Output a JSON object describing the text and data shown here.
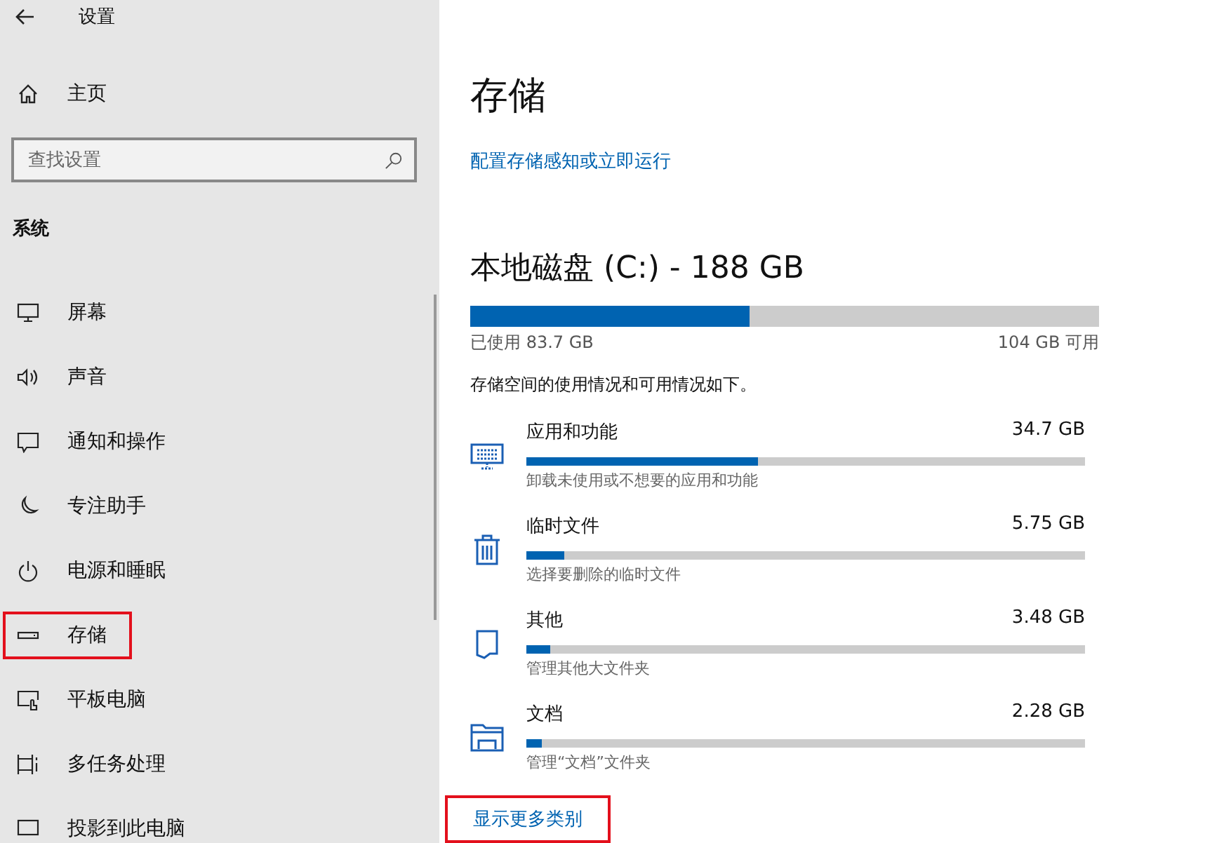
{
  "window": {
    "title": "设置"
  },
  "sidebar": {
    "home": "主页",
    "search": {
      "placeholder": "查找设置"
    },
    "section": "系统",
    "items": [
      {
        "label": "屏幕",
        "highlighted": false
      },
      {
        "label": "声音",
        "highlighted": false
      },
      {
        "label": "通知和操作",
        "highlighted": false
      },
      {
        "label": "专注助手",
        "highlighted": false
      },
      {
        "label": "电源和睡眠",
        "highlighted": false
      },
      {
        "label": "存储",
        "highlighted": true
      },
      {
        "label": "平板电脑",
        "highlighted": false
      },
      {
        "label": "多任务处理",
        "highlighted": false
      },
      {
        "label": "投影到此电脑",
        "highlighted": false
      }
    ]
  },
  "main": {
    "title": "存储",
    "config_link": "配置存储感知或立即运行",
    "disk": {
      "title": "本地磁盘 (C:) - 188 GB",
      "level": 0.445,
      "used": "已使用 83.7 GB",
      "free": "104 GB 可用"
    },
    "summary": "存储空间的使用情况和可用情况如下。",
    "categories": [
      {
        "name": "应用和功能",
        "size": "34.7 GB",
        "level": 0.415,
        "hint": "卸载未使用或不想要的应用和功能"
      },
      {
        "name": "临时文件",
        "size": "5.75 GB",
        "level": 0.068,
        "hint": "选择要删除的临时文件"
      },
      {
        "name": "其他",
        "size": "3.48 GB",
        "level": 0.042,
        "hint": "管理其他大文件夹"
      },
      {
        "name": "文档",
        "size": "2.28 GB",
        "level": 0.027,
        "hint": "管理“文档”文件夹"
      }
    ],
    "more_link": {
      "label": "显示更多类别",
      "highlighted": true
    }
  }
}
